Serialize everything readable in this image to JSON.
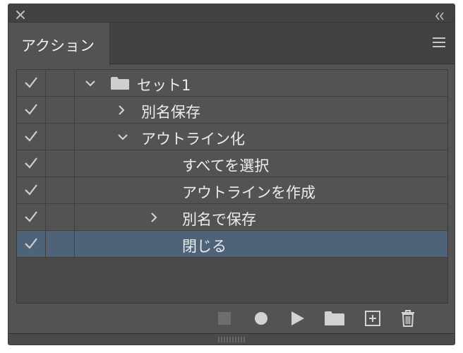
{
  "panel": {
    "tab_label": "アクション"
  },
  "actions": [
    {
      "label": "セット1",
      "kind": "set",
      "expanded": true,
      "checked": true,
      "selected": false
    },
    {
      "label": "別名保存",
      "kind": "action",
      "expanded": false,
      "checked": true,
      "selected": false
    },
    {
      "label": "アウトライン化",
      "kind": "action",
      "expanded": true,
      "checked": true,
      "selected": false
    },
    {
      "label": "すべてを選択",
      "kind": "step",
      "expanded": false,
      "checked": true,
      "selected": false
    },
    {
      "label": "アウトラインを作成",
      "kind": "step",
      "expanded": false,
      "checked": true,
      "selected": false
    },
    {
      "label": "別名で保存",
      "kind": "step",
      "expanded": false,
      "checked": true,
      "selected": false
    },
    {
      "label": "閉じる",
      "kind": "step",
      "expanded": false,
      "checked": true,
      "selected": true
    }
  ],
  "toolbar": {
    "icons": [
      "stop-icon",
      "record-icon",
      "play-icon",
      "new-set-icon",
      "new-action-icon",
      "trash-icon"
    ]
  },
  "colors": {
    "panel_bg": "#535353",
    "titlebar_bg": "#424242",
    "selection": "#4f6378",
    "icon": "#cfcfcf"
  }
}
